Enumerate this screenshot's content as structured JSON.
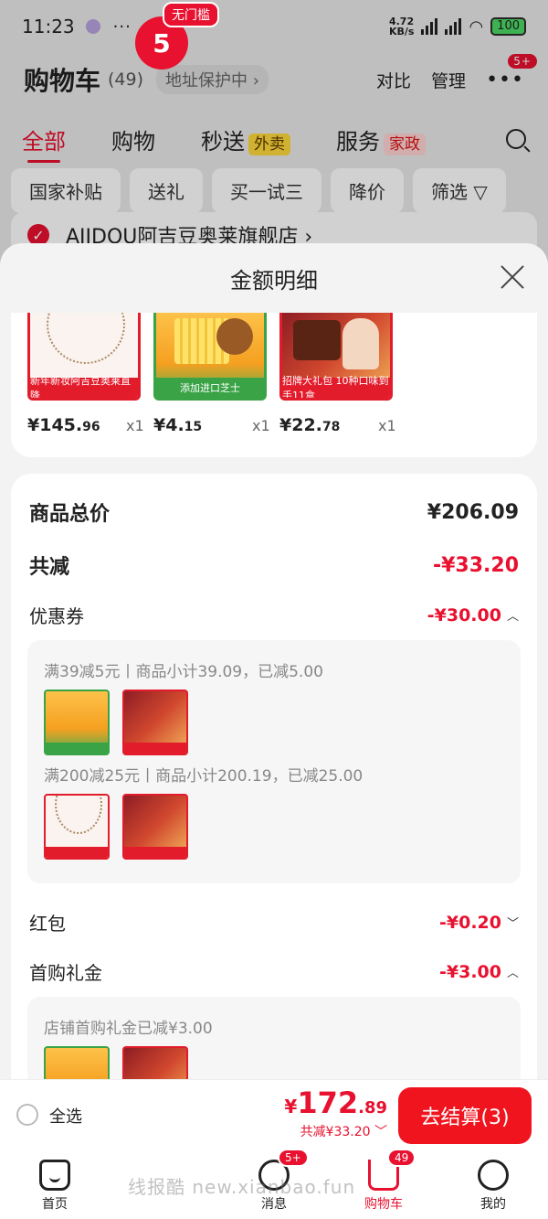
{
  "status_bar": {
    "time": "11:23",
    "more": "···",
    "speed": "4.72",
    "speed_unit": "KB/s",
    "battery": "100"
  },
  "cart_header": {
    "title": "购物车",
    "count": "(49)",
    "address": "地址保护中 ›",
    "compare": "对比",
    "manage": "管理",
    "badge": "5+"
  },
  "tabs": [
    {
      "label": "全部"
    },
    {
      "label": "购物"
    },
    {
      "label": "秒送",
      "tag": "外卖"
    },
    {
      "label": "服务",
      "tag": "家政"
    }
  ],
  "chips": [
    "国家补贴",
    "送礼",
    "买一试三",
    "降价",
    "筛选 ▽"
  ],
  "store": {
    "name": "AJIDOU阿吉豆奥莱旗舰店 ›"
  },
  "sheet": {
    "title": "金额明细",
    "items": [
      {
        "price_int": "¥145.",
        "price_dec": "96",
        "qty": "x1"
      },
      {
        "price_int": "¥4.",
        "price_dec": "15",
        "qty": "x1"
      },
      {
        "price_int": "¥22.",
        "price_dec": "78",
        "qty": "x1"
      }
    ],
    "thumb_strips": [
      "新年新妆阿吉豆奥莱直降",
      "添加进口芝士",
      "招牌大礼包 10种口味到手11盒"
    ],
    "total_label": "商品总价",
    "total_value": "¥206.09",
    "discount_label": "共减",
    "discount_value": "-¥33.20",
    "coupon_label": "优惠券",
    "coupon_value": "-¥30.00",
    "coupon_lines": [
      "满39减5元丨商品小计39.09，已减5.00",
      "满200减25元丨商品小计200.19，已减25.00"
    ],
    "redpacket_label": "红包",
    "redpacket_value": "-¥0.20",
    "firstbuy_label": "首购礼金",
    "firstbuy_value": "-¥3.00",
    "firstbuy_line": "店铺首购礼金已减¥3.00"
  },
  "checkout": {
    "select_all": "全选",
    "yen": "¥",
    "total_int": "172",
    "total_dec": ".89",
    "total_sub": "共减¥33.20 ﹀",
    "pay_label": "去结算(3)"
  },
  "bottom_nav": {
    "home": "首页",
    "messages": "消息",
    "messages_badge": "5+",
    "cart": "购物车",
    "cart_badge": "49",
    "me": "我的",
    "promo_tag": "无门槛",
    "promo_num": "5"
  },
  "watermark": "线报酷 new.xianbao.fun",
  "colors": {
    "accent": "#e8112f",
    "bg": "#f3f3f3"
  }
}
